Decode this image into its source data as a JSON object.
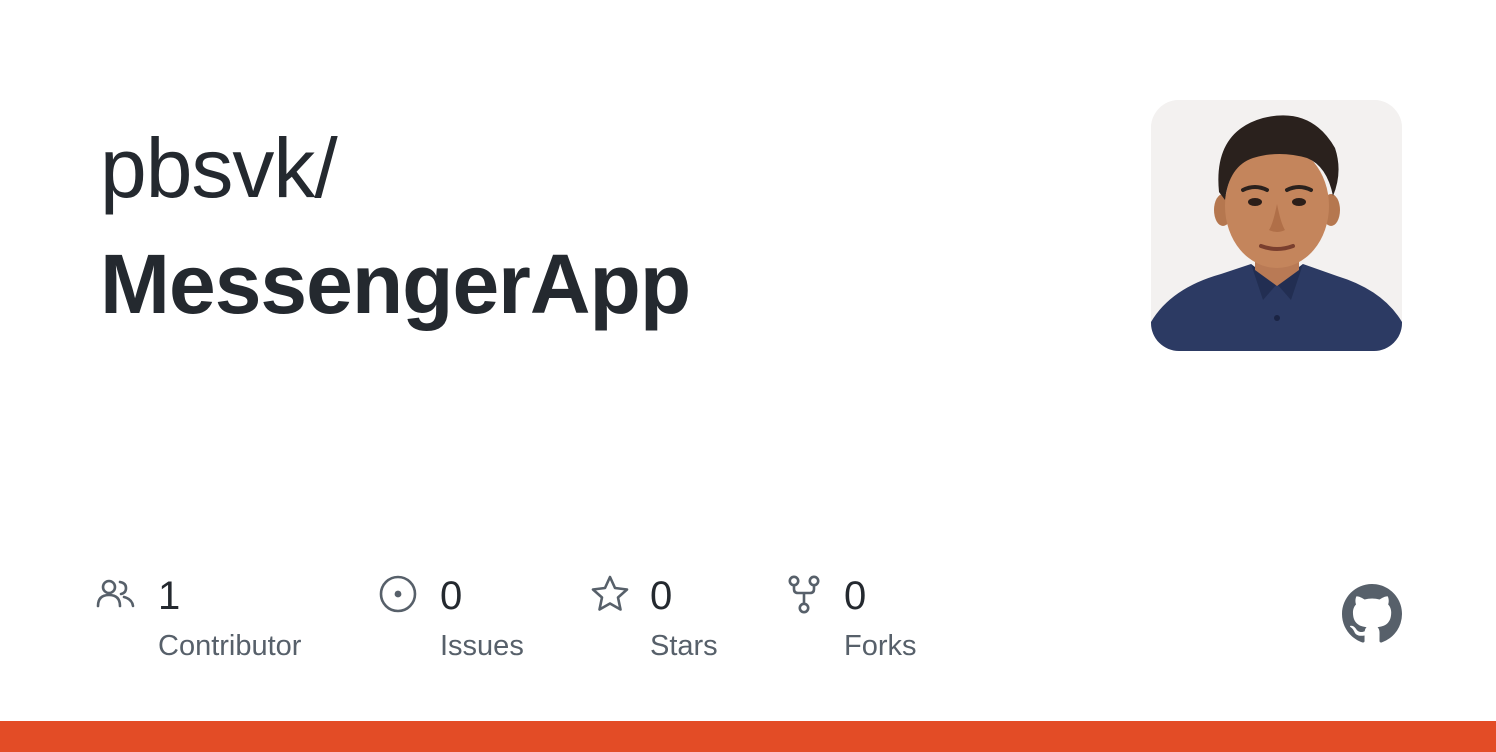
{
  "repo": {
    "owner": "pbsvk/",
    "name": "MessengerApp"
  },
  "avatar": {
    "alt": "avatar"
  },
  "stats": [
    {
      "icon": "people-icon",
      "value": "1",
      "label": "Contributor"
    },
    {
      "icon": "issue-opened-icon",
      "value": "0",
      "label": "Issues"
    },
    {
      "icon": "star-icon",
      "value": "0",
      "label": "Stars"
    },
    {
      "icon": "repo-forked-icon",
      "value": "0",
      "label": "Forks"
    }
  ],
  "colors": {
    "text": "#24292f",
    "muted": "#57606a",
    "language_bar": "#e34c26"
  }
}
